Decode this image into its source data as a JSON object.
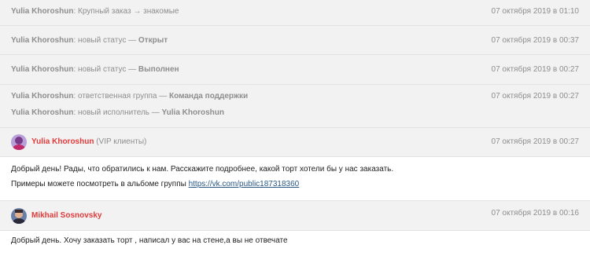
{
  "feed": {
    "events": [
      {
        "author": "Yulia Khoroshun",
        "text": ": Крупный заказ → знакомые",
        "time": "07 октября 2019 в 01:10"
      },
      {
        "author": "Yulia Khoroshun",
        "text": ": новый статус — ",
        "value": "Открыт",
        "time": "07 октября 2019 в 00:37"
      },
      {
        "author": "Yulia Khoroshun",
        "text": ": новый статус — ",
        "value": "Выполнен",
        "time": "07 октября 2019 в 00:27"
      },
      {
        "author": "Yulia Khoroshun",
        "text": ": ответственная группа — ",
        "value": "Команда поддержки",
        "time": "07 октября 2019 в 00:27",
        "author2": "Yulia Khoroshun",
        "text2": ": новый исполнитель — ",
        "value2": "Yulia Khoroshun"
      }
    ],
    "messages": [
      {
        "author": "Yulia Khoroshun",
        "role": " (VIP клиенты)",
        "time": "07 октября 2019 в 00:27",
        "line1": "Добрый день! Рады, что обратились к нам. Расскажите подробнее, какой торт хотели бы у нас заказать.",
        "line2": "Примеры можете посмотреть в альбоме группы ",
        "link": "https://vk.com/public187318360"
      },
      {
        "author": "Mikhail Sosnovsky",
        "time": "07 октября 2019 в 00:16",
        "line1": "Добрый день. Хочу заказать торт , написал у вас на стене,а вы не отвечате"
      }
    ]
  },
  "colors": {
    "accent": "#e23a3a",
    "link": "#2a5885",
    "event_bg": "#f2f2f2"
  }
}
